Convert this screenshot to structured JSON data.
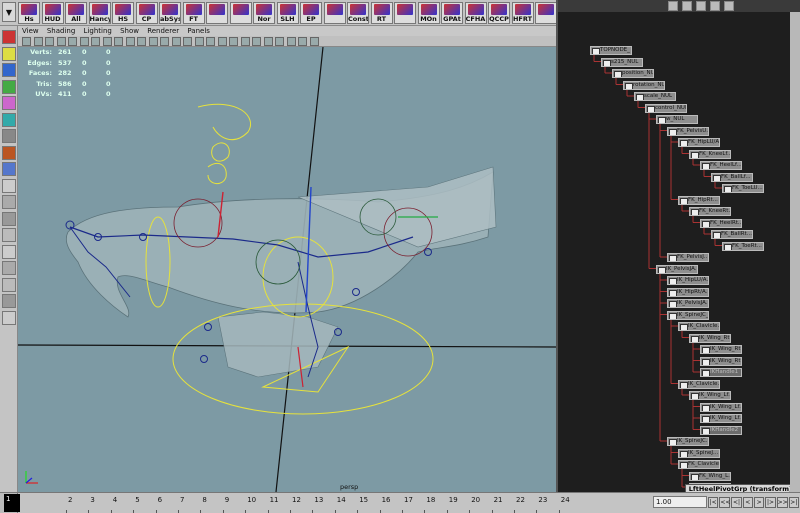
{
  "shelf": {
    "buttons": [
      "Hs",
      "HUD",
      "All",
      "Hancy",
      "HS",
      "CP",
      "abSys",
      "FT",
      "",
      "",
      "Nor",
      "SLH",
      "EP",
      "",
      "Const",
      "RT",
      "",
      "MOn",
      "GPAt",
      "CFHA",
      "QCCP",
      "HFRT",
      ""
    ]
  },
  "panel_menu": [
    "View",
    "Shading",
    "Lighting",
    "Show",
    "Renderer",
    "Panels"
  ],
  "hud": {
    "rows": [
      {
        "label": "Verts:",
        "a": "261",
        "b": "0",
        "c": "0"
      },
      {
        "label": "Edges:",
        "a": "537",
        "b": "0",
        "c": "0"
      },
      {
        "label": "Faces:",
        "a": "282",
        "b": "0",
        "c": "0"
      },
      {
        "label": "Tris:",
        "a": "586",
        "b": "0",
        "c": "0"
      },
      {
        "label": "UVs:",
        "a": "411",
        "b": "0",
        "c": "0"
      }
    ]
  },
  "viewport": {
    "camera": "persp"
  },
  "outliner": {
    "nodes": [
      "TOPNODE_",
      "s215_NUL",
      "position_NUL",
      "rotation_NUL",
      "scale_NUL",
      "control_NUL",
      "w_NUL",
      "FK_PelvisU...",
      "FK_HipLU/A...",
      "FK_KneeLf...",
      "FK_HeelLf...",
      "FK_BallLf...",
      "FK_ToeLU...",
      "FK_HipRt...",
      "FK_KneeRt...",
      "FK_HeelRt...",
      "FK_BallRt...",
      "FK_ToeRt...",
      "FK_PelvisJ...",
      "IK_PelvisJA...",
      "IK_HipLU/A...",
      "IK_HipRt/A...",
      "IK_PelvisJA...",
      "IK_SpineJC_1",
      "IK_Clavicle...",
      "IK_Wing_Rt...",
      "IK_Wing_Rt...",
      "IK_Wing_Rt...",
      "IKHandle1",
      "IK_Clavicle...",
      "IK_Wing_Lf...",
      "IK_Wing_Lf...",
      "IK_Wing_Lf...",
      "IKHandle2",
      "IK_SpineJC...",
      "IK_SpineJ...",
      "FK_Clavicle...",
      "FK_Wing_L...",
      "FK_Wing_..."
    ],
    "status": "LftHeelPivotGrp (transform)"
  },
  "timeline": {
    "ticks": [
      "2",
      "3",
      "4",
      "5",
      "6",
      "7",
      "8",
      "9",
      "10",
      "11",
      "12",
      "13",
      "14",
      "15",
      "16",
      "17",
      "18",
      "19",
      "20",
      "21",
      "22",
      "23",
      "24"
    ],
    "current_frame": "1",
    "current_frame_alt": "1",
    "frame_field": "1.00",
    "playback": [
      "|<",
      "<<",
      "<|",
      "<",
      ">",
      "|>",
      ">>",
      ">|"
    ]
  },
  "colors": {
    "viewport_bg": "#7d9aa4",
    "outliner_bg": "#1e1e1e",
    "node_bg": "#8e8e8e",
    "edge": "#aa3333",
    "curve_yellow": "#e6e23c"
  }
}
